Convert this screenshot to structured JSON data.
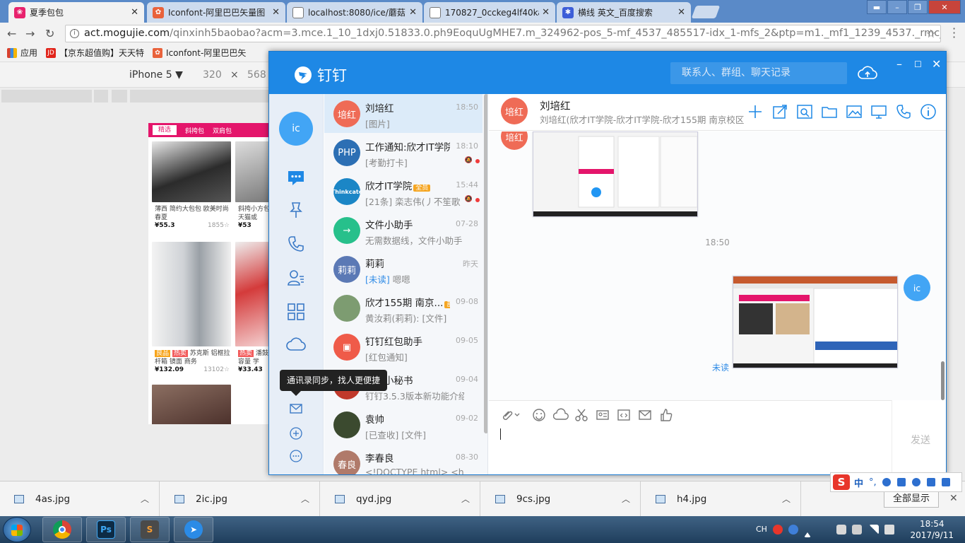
{
  "browser": {
    "tabs": [
      {
        "title": "夏季包包",
        "fav_color": "#e8226d",
        "fav_glyph": "❀"
      },
      {
        "title": "Iconfont-阿里巴巴矢量图",
        "fav_color": "#e9623b",
        "fav_glyph": "✿"
      },
      {
        "title": "localhost:8080/ice/蘑菇",
        "fav_color": "#ffffff",
        "fav_glyph": ""
      },
      {
        "title": "170827_0cckeg4lf40ka",
        "fav_color": "#ffffff",
        "fav_glyph": ""
      },
      {
        "title": "横线 英文_百度搜索",
        "fav_color": "#3d5ed8",
        "fav_glyph": "🐾"
      }
    ],
    "url_host": "act.mogujie.com",
    "url_path": "/qinxinh5baobao?acm=3.mce.1_10_1dxj0.51833.0.ph9EoquUgMHE7.m_324962-pos_5-mf_4537_485517-idx_1-mfs_2&ptp=m1._mf1_1239_4537._rmc_51833.0....",
    "bookmarks": [
      {
        "label": "应用",
        "icon": "apps-icon",
        "color": "#d8402e"
      },
      {
        "label": "【京东超值购】天天特",
        "icon": "jd-icon",
        "color": "#e1251b",
        "icon_text": "JD"
      },
      {
        "label": "Iconfont-阿里巴巴矢",
        "icon": "iconfont-icon",
        "color": "#e9623b"
      }
    ],
    "device_name": "iPhone 5 ▼",
    "device_w": "320",
    "device_x": "×",
    "device_h": "568"
  },
  "phone_page": {
    "tabs": [
      "精选",
      "斜挎包",
      "双肩包"
    ],
    "cards": [
      {
        "title": "薄西 简约大包包 欧美时尚 春夏",
        "price": "¥55.3",
        "sales": "1855☆"
      },
      {
        "title": "斜挎小方包 天猫或",
        "price": "¥53",
        "sales": ""
      },
      {
        "tag1": "良品",
        "tag2": "热卖",
        "title": "苏克斯 铝框拉杆箱 镜面 商务",
        "price": "¥132.09",
        "sales": "13102☆"
      },
      {
        "tag1": "热卖",
        "title": "潘鼓 大容量 学",
        "price": "¥33.43",
        "sales": ""
      }
    ]
  },
  "downloads": {
    "items": [
      "4as.jpg",
      "2ic.jpg",
      "qyd.jpg",
      "9cs.jpg",
      "h4.jpg"
    ],
    "show_all": "全部显示"
  },
  "ime": {
    "lang": "中",
    "punct": "°,"
  },
  "taskbar": {
    "apps": [
      "chrome",
      "photoshop",
      "sublime",
      "dingtalk"
    ],
    "lang": "CH",
    "time": "18:54",
    "date": "2017/9/11"
  },
  "dingtalk": {
    "app_name": "钉钉",
    "search_placeholder": "联系人、群组、聊天记录",
    "me_label": "ic",
    "tooltip": "通讯录同步，找人更便捷",
    "conversations": [
      {
        "avatar": "培红",
        "avatar_color": "#ef6b56",
        "name": "刘培红",
        "time": "18:50",
        "preview": "[图片]"
      },
      {
        "avatar": "PHP",
        "avatar_color": "#2c6fb4",
        "name": "工作通知:欣才IT学院",
        "time": "18:10",
        "preview": "[考勤打卡]"
      },
      {
        "avatar": "Thinkcate",
        "avatar_color": "#1b86c6",
        "name": "欣才IT学院",
        "badge": "全员",
        "time": "15:44",
        "preview": "[21条] 栾志伟(丿不笙歌"
      },
      {
        "avatar": "→",
        "avatar_color": "#27c08b",
        "name": "文件小助手",
        "time": "07-28",
        "preview": "无需数据线，文件小助手"
      },
      {
        "avatar": "莉莉",
        "avatar_color": "#5b79b5",
        "name": "莉莉",
        "time": "昨天",
        "preview_unread": "[未读]",
        "preview": " 嗯嗯"
      },
      {
        "avatar": "",
        "avatar_color": "#7d9c71",
        "name": "欣才155期 南京...",
        "badge": "部门",
        "time": "09-08",
        "preview": "黄汝莉(莉莉): [文件]"
      },
      {
        "avatar": "▣",
        "avatar_color": "#ef5b49",
        "name": "钉钉红包助手",
        "time": "09-05",
        "preview": "[红包通知]"
      },
      {
        "avatar": "",
        "avatar_color": "#c0392b",
        "name": "钉钉小秘书",
        "time": "09-04",
        "preview": "钉钉3.5.3版本新功能介绍"
      },
      {
        "avatar": "",
        "avatar_color": "#3b4a2f",
        "name": "袁帅",
        "time": "09-02",
        "preview": "[已查收] [文件]"
      },
      {
        "avatar": "春良",
        "avatar_color": "#b07a6a",
        "name": "李春良",
        "time": "08-30",
        "preview": "<!DOCTYPE html> <ht..."
      }
    ],
    "chat": {
      "name": "刘培红",
      "avatar": "培红",
      "subtitle": "刘培红(欣才IT学院-欣才IT学院-欣才155期 南京校区...",
      "timestamp": "18:50",
      "my_avatar": "ic",
      "unread_label": "未读",
      "send_label": "发送"
    }
  },
  "colors": {
    "accent": "#1e88e5",
    "unread": "#2f8be6",
    "badge_red": "#f03b3b",
    "badge_orange": "#f5a623"
  }
}
